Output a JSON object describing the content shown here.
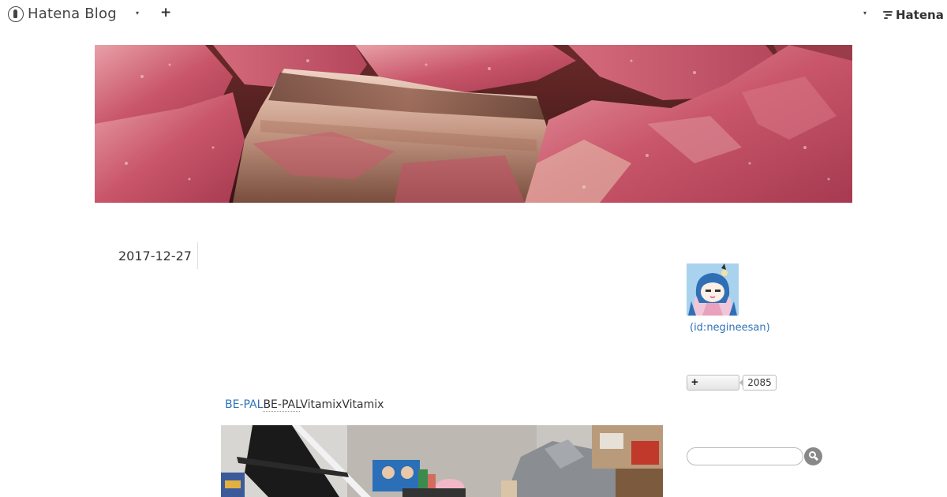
{
  "global_header": {
    "logo_text": "Hatena Blog",
    "logo_icon": "hatena-blog-logo-icon",
    "menu_caret": "▾",
    "add_icon": "plus-icon",
    "add_glyph": "+",
    "user_caret": "▾",
    "brand_text": "Hatena",
    "brand_icon": "hatena-logo-icon"
  },
  "banner": {
    "image": "meat-banner-image"
  },
  "entry": {
    "date": "2017-12-27",
    "line_link": "BE-PAL",
    "line_underlined": "BE-PAL",
    "line_rest": "VitamixVitamix",
    "photo": "entry-photo"
  },
  "sidebar": {
    "avatar": "profile-avatar",
    "profile_id": "(id:negineesan)",
    "follow_glyph": "+",
    "follow_count": "2085",
    "search_placeholder": "",
    "search_icon": "search-icon"
  }
}
